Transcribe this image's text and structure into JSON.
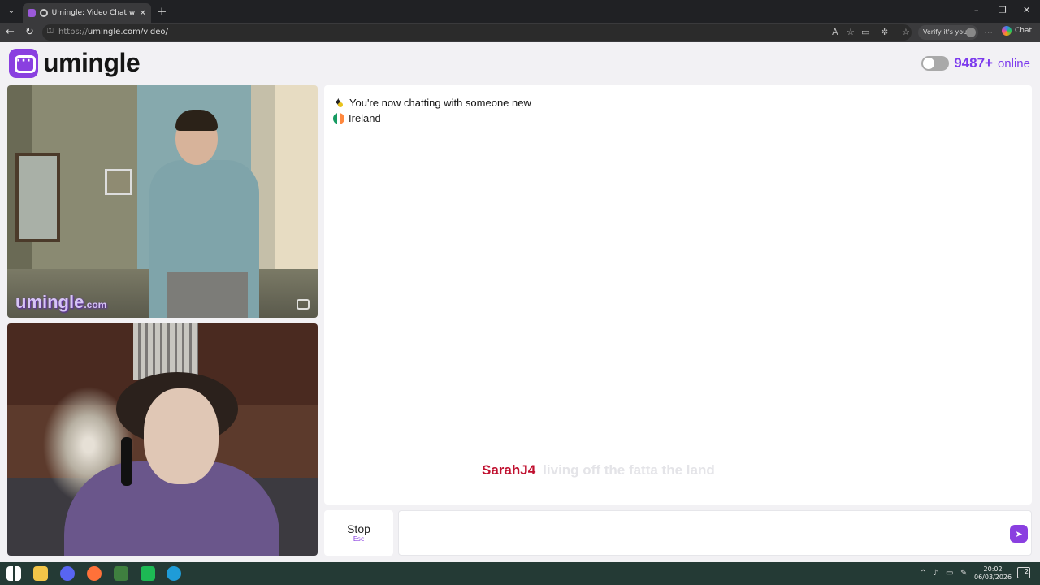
{
  "browser": {
    "tab_title": "Umingle: Video Chat with Stra",
    "tab_close": "✕",
    "new_tab": "+",
    "url_protocol": "https://",
    "url_rest": "umingle.com/video/",
    "verify_label": "Verify it's you",
    "chat_label": "Chat",
    "window_controls": [
      "–",
      "❐",
      "✕"
    ]
  },
  "header": {
    "logo_text": "umingle",
    "online_count": "9487+",
    "online_label": "online"
  },
  "video": {
    "watermark_brand": "umingle",
    "watermark_domain": ".com"
  },
  "chat": {
    "system_message": "You're now chatting with someone new",
    "country": "Ireland",
    "flag_colors": [
      "#169b62",
      "#ffffff",
      "#ff883e"
    ],
    "caption_name": "SarahJ4",
    "caption_message": "living off the fatta the land"
  },
  "controls": {
    "stop_label": "Stop",
    "stop_key": "Esc",
    "message_value": "",
    "send_icon": "send-icon"
  },
  "taskbar": {
    "time": "20:02",
    "date": "06/03/2026",
    "notification_count": "2"
  },
  "colors": {
    "accent": "#8a3fe0",
    "online": "#7c3aed",
    "caption_name": "#c0102f"
  }
}
